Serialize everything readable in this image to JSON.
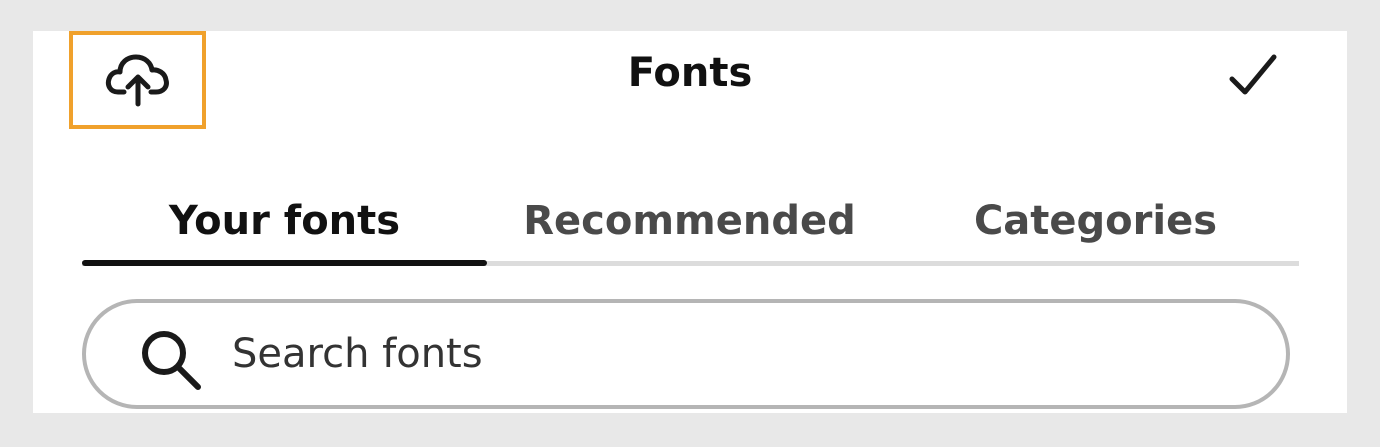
{
  "header": {
    "title": "Fonts",
    "upload_icon": "cloud-upload-icon",
    "done_icon": "checkmark-icon"
  },
  "tabs": [
    {
      "label": "Your fonts",
      "selected": true
    },
    {
      "label": "Recommended",
      "selected": false
    },
    {
      "label": "Categories",
      "selected": false
    }
  ],
  "search": {
    "placeholder": "Search fonts",
    "value": "",
    "icon": "search-icon"
  },
  "colors": {
    "highlight": "#f0a12c",
    "text_primary": "#111111",
    "text_secondary": "#4a4a4a",
    "tab_track": "#dcdcdc",
    "search_border": "#b5b5b5",
    "background": "#e8e8e8"
  }
}
